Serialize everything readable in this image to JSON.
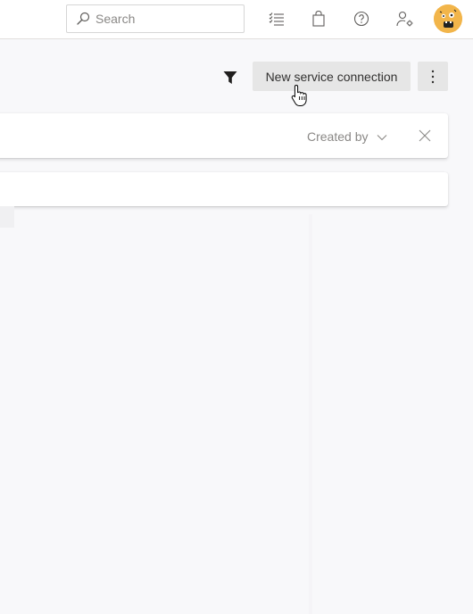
{
  "header": {
    "search": {
      "placeholder": "Search",
      "icon": "search-icon"
    },
    "icons": [
      "task-list-icon",
      "marketplace-bag-icon",
      "help-icon",
      "user-settings-icon"
    ],
    "avatar": {
      "icon": "avatar-icon",
      "color": "#f2b54a"
    }
  },
  "toolbar": {
    "filter_icon": "filter-icon",
    "new_button_label": "New service connection",
    "more_icon": "more-vertical-icon"
  },
  "filterbar": {
    "created_by_label": "Created by",
    "dropdown_icon": "chevron-down-icon",
    "close_icon": "close-icon"
  },
  "colors": {
    "background": "#f8f8fa",
    "button": "#e6e6e6",
    "text": "#323130",
    "muted": "#8a8886",
    "card": "#ffffff"
  }
}
